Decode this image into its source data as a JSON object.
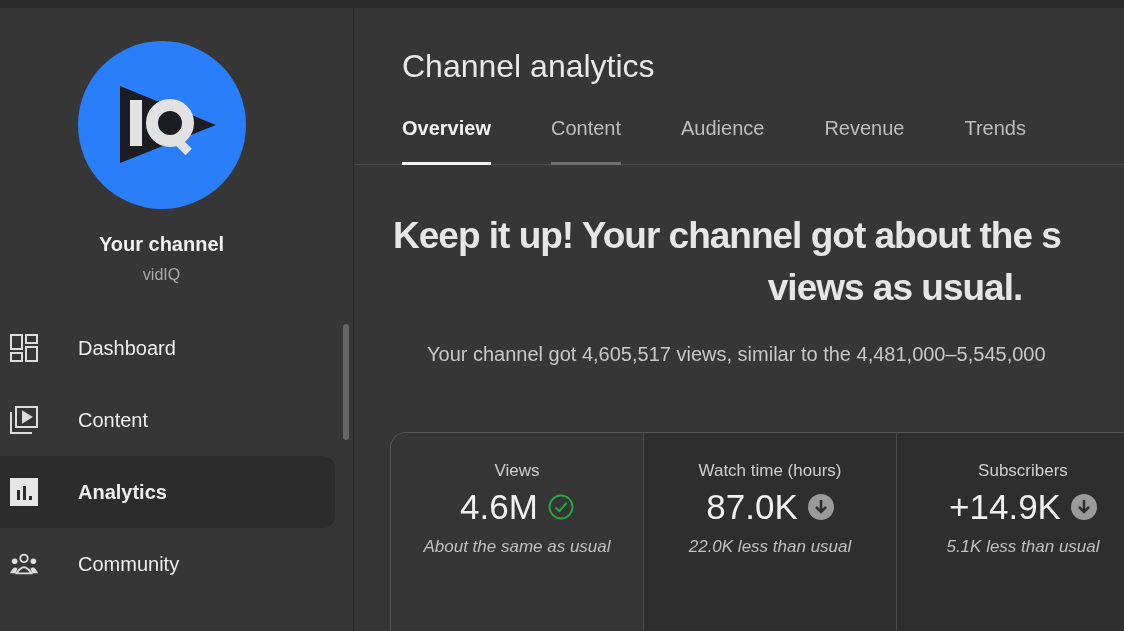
{
  "sidebar": {
    "channel_title": "Your channel",
    "channel_name": "vidIQ",
    "items": [
      {
        "label": "Dashboard",
        "kind": "dashboard",
        "selected": false
      },
      {
        "label": "Content",
        "kind": "content",
        "selected": false
      },
      {
        "label": "Analytics",
        "kind": "analytics",
        "selected": true
      },
      {
        "label": "Community",
        "kind": "community",
        "selected": false
      }
    ]
  },
  "main": {
    "title": "Channel analytics",
    "tabs": [
      {
        "label": "Overview",
        "selected": true,
        "hovered": false
      },
      {
        "label": "Content",
        "selected": false,
        "hovered": true
      },
      {
        "label": "Audience",
        "selected": false,
        "hovered": false
      },
      {
        "label": "Revenue",
        "selected": false,
        "hovered": false
      },
      {
        "label": "Trends",
        "selected": false,
        "hovered": false
      }
    ],
    "headline_lines": [
      "Keep it up! Your channel got about the s",
      "views as usual."
    ],
    "summary": "Your channel got 4,605,517 views, similar to the 4,481,000–5,545,000",
    "metrics": [
      {
        "label": "Views",
        "value": "4.6M",
        "kind": "check",
        "note": "About the same as usual"
      },
      {
        "label": "Watch time (hours)",
        "value": "87.0K",
        "kind": "down",
        "note": "22.0K less than usual"
      },
      {
        "label": "Subscribers",
        "value": "+14.9K",
        "kind": "down",
        "note": "5.1K less than usual"
      }
    ]
  }
}
